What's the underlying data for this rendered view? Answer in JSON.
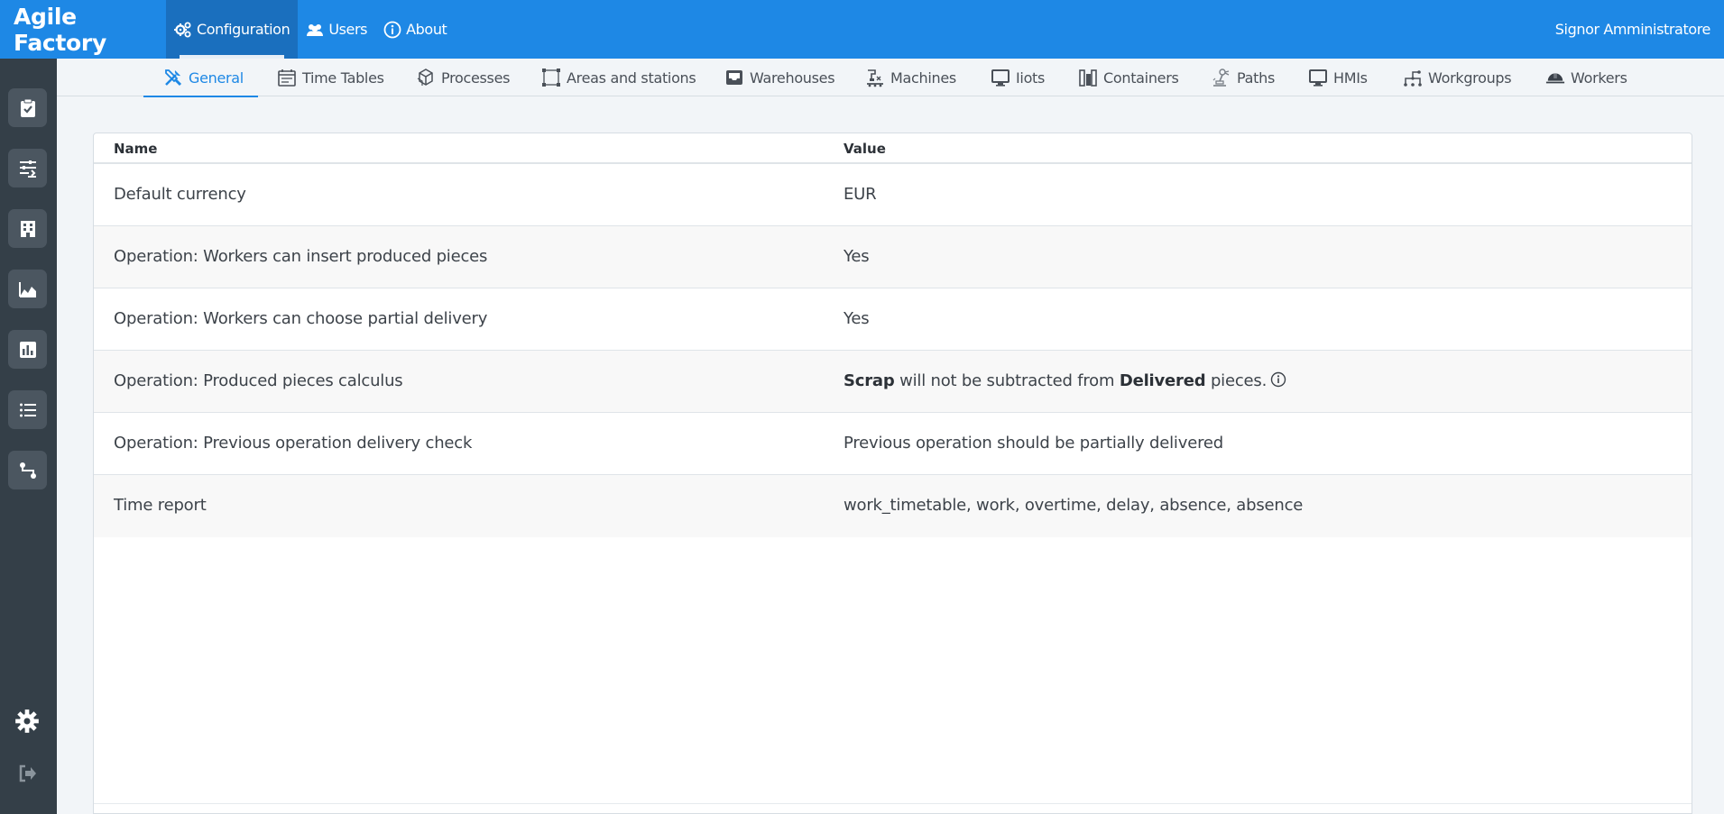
{
  "app": {
    "title": "Agile Factory"
  },
  "topnav": {
    "items": [
      {
        "label": "Configuration",
        "icon": "gears-icon"
      },
      {
        "label": "Users",
        "icon": "users-icon"
      },
      {
        "label": "About",
        "icon": "info-icon"
      }
    ],
    "user": "Signor Amministratore"
  },
  "sidebar": {
    "items": [
      {
        "icon": "clipboard-check-icon"
      },
      {
        "icon": "sliders-icon"
      },
      {
        "icon": "building-icon"
      },
      {
        "icon": "area-chart-icon"
      },
      {
        "icon": "bar-chart-icon"
      },
      {
        "icon": "list-icon"
      },
      {
        "icon": "route-icon"
      }
    ],
    "bottom": [
      {
        "icon": "gear-icon"
      },
      {
        "icon": "logout-icon"
      }
    ]
  },
  "subtabs": [
    {
      "label": "General",
      "icon": "tools-icon"
    },
    {
      "label": "Time Tables",
      "icon": "calendar-icon"
    },
    {
      "label": "Processes",
      "icon": "cubes-icon"
    },
    {
      "label": "Areas and stations",
      "icon": "area-select-icon"
    },
    {
      "label": "Warehouses",
      "icon": "inbox-icon"
    },
    {
      "label": "Machines",
      "icon": "machine-icon"
    },
    {
      "label": "Iiots",
      "icon": "monitor-icon"
    },
    {
      "label": "Containers",
      "icon": "containers-icon"
    },
    {
      "label": "Paths",
      "icon": "robot-arm-icon"
    },
    {
      "label": "HMIs",
      "icon": "monitor-icon"
    },
    {
      "label": "Workgroups",
      "icon": "workgroup-icon"
    },
    {
      "label": "Workers",
      "icon": "hardhat-icon"
    }
  ],
  "table": {
    "headers": {
      "name": "Name",
      "value": "Value"
    },
    "rows": [
      {
        "name": "Default currency",
        "value": "EUR"
      },
      {
        "name": "Operation: Workers can insert produced pieces",
        "value": "Yes"
      },
      {
        "name": "Operation: Workers can choose partial delivery",
        "value": "Yes"
      },
      {
        "name": "Operation: Produced pieces calculus",
        "value_parts": {
          "bold1": "Scrap",
          "text1": " will not be subtracted from ",
          "bold2": "Delivered",
          "text2": " pieces."
        }
      },
      {
        "name": "Operation: Previous operation delivery check",
        "value": "Previous operation should be partially delivered"
      },
      {
        "name": "Time report",
        "value": "work_timetable, work, overtime, delay, absence, absence"
      }
    ]
  },
  "colors": {
    "topbar": "#1e88e5",
    "sidebar": "#343f48",
    "accent": "#1e88e5"
  }
}
